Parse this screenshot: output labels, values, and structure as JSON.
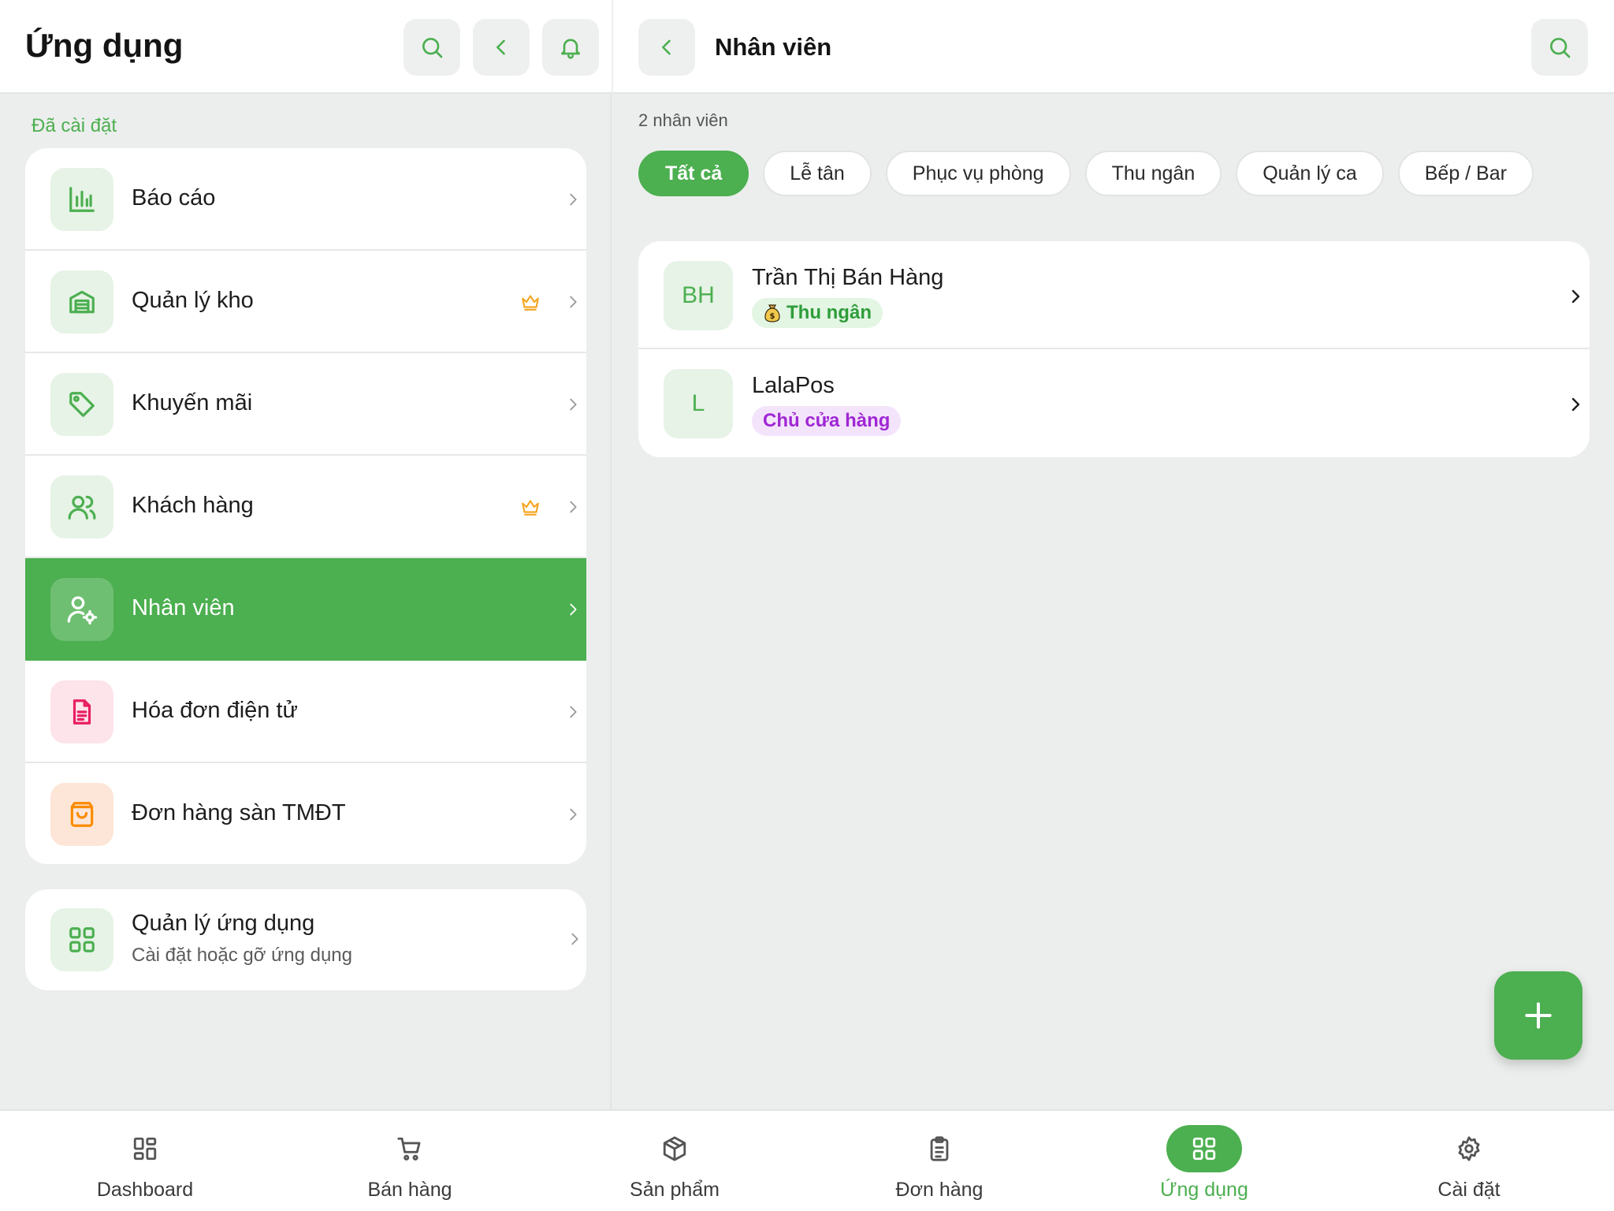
{
  "colors": {
    "accent": "#4caf50",
    "crown": "#f5a623",
    "invoice": "#e91e63",
    "marketplace": "#fb8c00",
    "owner_role": "#a027d3"
  },
  "left": {
    "title": "Ứng dụng",
    "section_label": "Đã cài đặt",
    "menu": [
      {
        "label": "Báo cáo",
        "icon": "bar-chart-icon",
        "premium": false
      },
      {
        "label": "Quản lý kho",
        "icon": "warehouse-icon",
        "premium": true
      },
      {
        "label": "Khuyến mãi",
        "icon": "tag-icon",
        "premium": false
      },
      {
        "label": "Khách hàng",
        "icon": "users-icon",
        "premium": true
      },
      {
        "label": "Nhân viên",
        "icon": "user-gear-icon",
        "premium": false,
        "active": true
      },
      {
        "label": "Hóa đơn điện tử",
        "icon": "invoice-icon",
        "premium": false
      },
      {
        "label": "Đơn hàng sàn TMĐT",
        "icon": "shopping-bag-icon",
        "premium": false
      }
    ],
    "app_manager": {
      "title": "Quản lý ứng dụng",
      "subtitle": "Cài đặt hoặc gỡ ứng dụng"
    }
  },
  "right": {
    "title": "Nhân viên",
    "count_label": "2 nhân viên",
    "filters": [
      "Tất cả",
      "Lễ tân",
      "Phục vụ phòng",
      "Thu ngân",
      "Quản lý ca",
      "Bếp / Bar"
    ],
    "active_filter": "Tất cả",
    "staff": [
      {
        "initials": "BH",
        "name": "Trần Thị Bán Hàng",
        "role": "Thu ngân",
        "role_emoji": "💰"
      },
      {
        "initials": "L",
        "name": "LalaPos",
        "role": "Chủ cửa hàng",
        "role_emoji": ""
      }
    ]
  },
  "bottom_nav": [
    {
      "label": "Dashboard",
      "icon": "dashboard-icon"
    },
    {
      "label": "Bán hàng",
      "icon": "cart-icon"
    },
    {
      "label": "Sản phẩm",
      "icon": "box-icon"
    },
    {
      "label": "Đơn hàng",
      "icon": "clipboard-icon"
    },
    {
      "label": "Ứng dụng",
      "icon": "apps-grid-icon",
      "active": true
    },
    {
      "label": "Cài đặt",
      "icon": "settings-gear-icon"
    }
  ]
}
